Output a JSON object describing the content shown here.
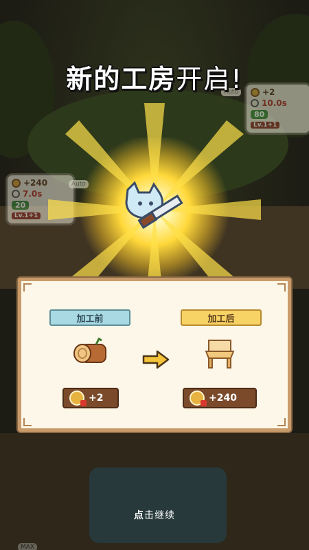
{
  "popup_title": {
    "bold_part": "新的工房",
    "light_part": "开启!"
  },
  "left_bubble": {
    "reward": "+240",
    "time": "7.0s",
    "cost": "20",
    "level": "Lv.1+1"
  },
  "right_bubble": {
    "reward": "+2",
    "time": "10.0s",
    "cost": "80",
    "level": "Lv.1+1"
  },
  "auto_tags": [
    "Auto",
    "Auto"
  ],
  "max_tag": "MAX",
  "panel": {
    "before_label": "加工前",
    "after_label": "加工后",
    "before_item_icon": "log-icon",
    "after_item_icon": "chair-icon",
    "before_reward": "+2",
    "after_reward": "+240"
  },
  "continue_prompt": {
    "bold_part": "点",
    "light_part": "击继续"
  },
  "colors": {
    "panel_bg": "#fcf7e8",
    "panel_border": "#c99b6a",
    "glow": "#ffd83a",
    "before_ribbon": "#a9d9e2",
    "after_ribbon": "#f7d365",
    "reward_bg": "#7a4a2a"
  }
}
